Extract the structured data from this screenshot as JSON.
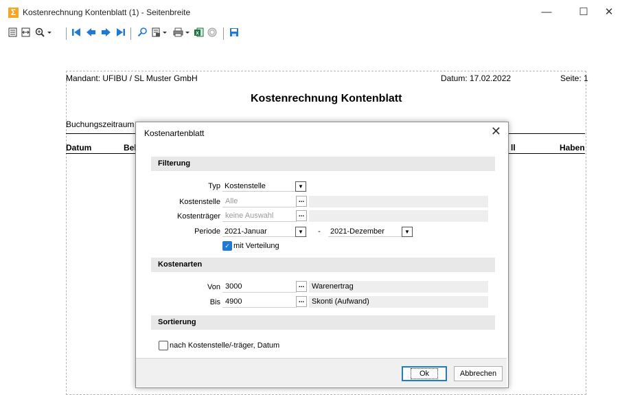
{
  "window": {
    "title": "Kostenrechnung Kontenblatt (1) - Seitenbreite",
    "minimize": "—",
    "maximize": "☐",
    "close": "✕"
  },
  "toolbar": {
    "icons": [
      "single-page-icon",
      "page-width-icon",
      "zoom-icon",
      "first-page-icon",
      "previous-page-icon",
      "next-page-icon",
      "last-page-icon",
      "search-icon",
      "export-icon",
      "print-icon",
      "excel-icon",
      "cancel-icon",
      "save-icon"
    ]
  },
  "report": {
    "mandant": "Mandant: UFIBU / SL Muster GmbH",
    "datum": "Datum: 17.02.2022",
    "seite": "Seite: 1",
    "title": "Kostenrechnung Kontenblatt",
    "buchungszeitraum": "Buchungszeitraum",
    "col_datum": "Datum",
    "col_beleg": "Bel",
    "col_soll": "ll",
    "col_haben": "Haben"
  },
  "dialog": {
    "title": "Kostenartenblatt",
    "close": "✕",
    "filter": {
      "header": "Filterung",
      "typ_label": "Typ",
      "typ_value": "Kostenstelle",
      "kostenstelle_label": "Kostenstelle",
      "kostenstelle_value": "Alle",
      "kostentraeger_label": "Kostenträger",
      "kostentraeger_value": "keine Auswahl",
      "periode_label": "Periode",
      "periode_from": "2021-Januar",
      "periode_sep": "-",
      "periode_to": "2021-Dezember",
      "verteilung_label": "mit Verteilung",
      "verteilung_checked": true
    },
    "kostenarten": {
      "header": "Kostenarten",
      "von_label": "Von",
      "von_value": "3000",
      "von_desc": "Warenertrag",
      "bis_label": "Bis",
      "bis_value": "4900",
      "bis_desc": "Skonti (Aufwand)"
    },
    "sortierung": {
      "header": "Sortierung",
      "option_label": "nach Kostenstelle/-träger, Datum",
      "option_checked": false
    },
    "buttons": {
      "ok": "Ok",
      "cancel": "Abbrechen"
    },
    "ellipsis": "..."
  },
  "colors": {
    "accent": "#1e7ad6",
    "section_bg": "#e8e8e8",
    "app_icon": "#f5a623"
  }
}
